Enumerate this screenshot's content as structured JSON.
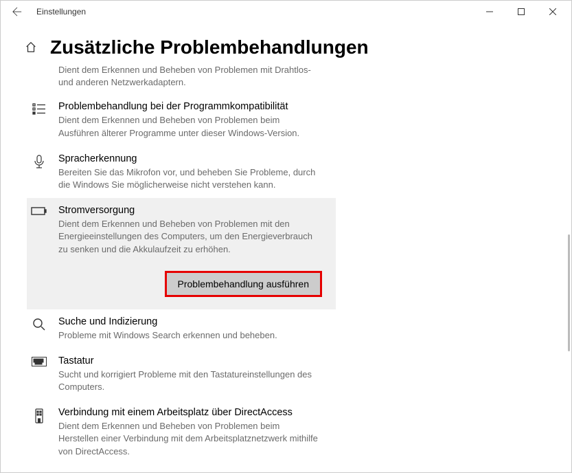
{
  "titlebar": {
    "app_title": "Einstellungen"
  },
  "page": {
    "heading": "Zusätzliche Problembehandlungen"
  },
  "items": {
    "partial_top_desc": "Dient dem Erkennen und Beheben von Problemen mit Drahtlos- und anderen Netzwerkadaptern.",
    "compat": {
      "title": "Problembehandlung bei der Programmkompatibilität",
      "desc": "Dient dem Erkennen und Beheben von Problemen beim Ausführen älterer Programme unter dieser Windows-Version."
    },
    "speech": {
      "title": "Spracherkennung",
      "desc": "Bereiten Sie das Mikrofon vor, und beheben Sie Probleme, durch die Windows Sie möglicherweise nicht verstehen kann."
    },
    "power": {
      "title": "Stromversorgung",
      "desc": "Dient dem Erkennen und Beheben von Problemen mit den Energieeinstellungen des Computers, um den Energieverbrauch zu senken und die Akkulaufzeit zu erhöhen.",
      "button": "Problembehandlung ausführen"
    },
    "search": {
      "title": "Suche und Indizierung",
      "desc": "Probleme mit Windows Search erkennen und beheben."
    },
    "keyboard": {
      "title": "Tastatur",
      "desc": "Sucht und korrigiert Probleme mit den Tastatureinstellungen des Computers."
    },
    "directaccess": {
      "title": "Verbindung mit einem Arbeitsplatz über DirectAccess",
      "desc": "Dient dem Erkennen und Beheben von Problemen beim Herstellen einer Verbindung mit dem Arbeitsplatznetzwerk mithilfe von DirectAccess."
    }
  }
}
